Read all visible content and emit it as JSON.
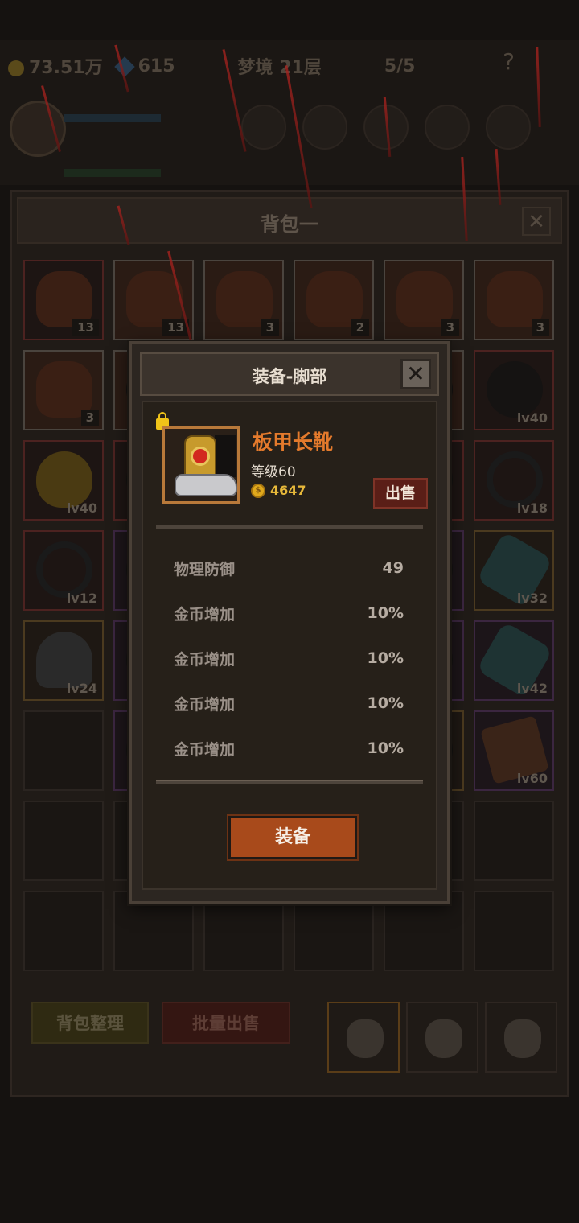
{
  "hud": {
    "gold": "73.51万",
    "gems": "615",
    "stage": "梦境 21层",
    "keys": "5/5",
    "help": "?"
  },
  "bag": {
    "title": "背包一",
    "close": "✕",
    "sort_label": "背包整理",
    "batch_sell_label": "批量出售",
    "slots": [
      {
        "type": "potion",
        "style": "red",
        "badge": "13"
      },
      {
        "type": "potion",
        "style": "gray",
        "badge": "13"
      },
      {
        "type": "potion",
        "style": "gray",
        "badge": "3"
      },
      {
        "type": "potion",
        "style": "gray",
        "badge": "2"
      },
      {
        "type": "potion",
        "style": "gray",
        "badge": "3"
      },
      {
        "type": "potion",
        "style": "gray",
        "badge": "3"
      },
      {
        "type": "potion",
        "style": "gray",
        "badge": "3"
      },
      {
        "type": "dark",
        "style": "gray",
        "badge": ""
      },
      {
        "type": "dark",
        "style": "gray",
        "badge": ""
      },
      {
        "type": "dark",
        "style": "gray",
        "badge": ""
      },
      {
        "type": "dark",
        "style": "gray",
        "badge": ""
      },
      {
        "type": "dark",
        "style": "red",
        "lv": "lv40"
      },
      {
        "type": "egg",
        "style": "red",
        "lv": "lv40"
      },
      {
        "type": "dark",
        "style": "red",
        "lv": ""
      },
      {
        "type": "dark",
        "style": "red",
        "lv": ""
      },
      {
        "type": "dark",
        "style": "red",
        "lv": ""
      },
      {
        "type": "dark",
        "style": "red",
        "lv": ""
      },
      {
        "type": "ring",
        "style": "red",
        "lv": "lv18"
      },
      {
        "type": "ring",
        "style": "red",
        "lv": "lv12"
      },
      {
        "type": "dark",
        "style": "purple",
        "lv": ""
      },
      {
        "type": "dark",
        "style": "purple",
        "lv": ""
      },
      {
        "type": "dark",
        "style": "purple",
        "lv": ""
      },
      {
        "type": "dark",
        "style": "purple",
        "lv": ""
      },
      {
        "type": "shard",
        "style": "gold",
        "lv": "lv32"
      },
      {
        "type": "helm",
        "style": "gold",
        "lv": "lv24"
      },
      {
        "type": "dark",
        "style": "purple",
        "lv": ""
      },
      {
        "type": "dark",
        "style": "purple",
        "lv": ""
      },
      {
        "type": "dark",
        "style": "purple",
        "lv": ""
      },
      {
        "type": "dark",
        "style": "purple",
        "lv": ""
      },
      {
        "type": "shard",
        "style": "purple",
        "lv": "lv42"
      },
      {
        "type": "empty",
        "style": "empty",
        "lv": ""
      },
      {
        "type": "dark",
        "style": "purple",
        "lv": ""
      },
      {
        "type": "dark",
        "style": "purple",
        "lv": ""
      },
      {
        "type": "dark",
        "style": "purple",
        "lv": ""
      },
      {
        "type": "dark",
        "style": "gold",
        "lv": ""
      },
      {
        "type": "box",
        "style": "purple",
        "lv": "lv60"
      },
      {
        "type": "empty",
        "style": "empty",
        "lv": ""
      },
      {
        "type": "empty",
        "style": "empty",
        "lv": ""
      },
      {
        "type": "empty",
        "style": "empty",
        "lv": ""
      },
      {
        "type": "empty",
        "style": "empty",
        "lv": ""
      },
      {
        "type": "empty",
        "style": "empty",
        "lv": ""
      },
      {
        "type": "empty",
        "style": "empty",
        "lv": ""
      },
      {
        "type": "empty",
        "style": "empty",
        "lv": ""
      },
      {
        "type": "empty",
        "style": "empty",
        "lv": ""
      },
      {
        "type": "empty",
        "style": "empty",
        "lv": ""
      },
      {
        "type": "empty",
        "style": "empty",
        "lv": ""
      },
      {
        "type": "empty",
        "style": "empty",
        "lv": ""
      },
      {
        "type": "empty",
        "style": "empty",
        "lv": ""
      }
    ]
  },
  "modal": {
    "title": "装备-脚部",
    "close": "✕",
    "item_name": "板甲长靴",
    "level": "等级60",
    "coin_symbol": "$",
    "price": "4647",
    "sell_label": "出售",
    "stats": [
      {
        "name": "物理防御",
        "value": "49"
      },
      {
        "name": "金币增加",
        "value": "10%"
      },
      {
        "name": "金币增加",
        "value": "10%"
      },
      {
        "name": "金币增加",
        "value": "10%"
      },
      {
        "name": "金币增加",
        "value": "10%"
      }
    ],
    "equip_label": "装备"
  },
  "colors": {
    "item_name": "#e47a2c",
    "equip_button": "#a84a1b",
    "sell_button": "#5a1e17",
    "coin": "#e6b83a"
  }
}
